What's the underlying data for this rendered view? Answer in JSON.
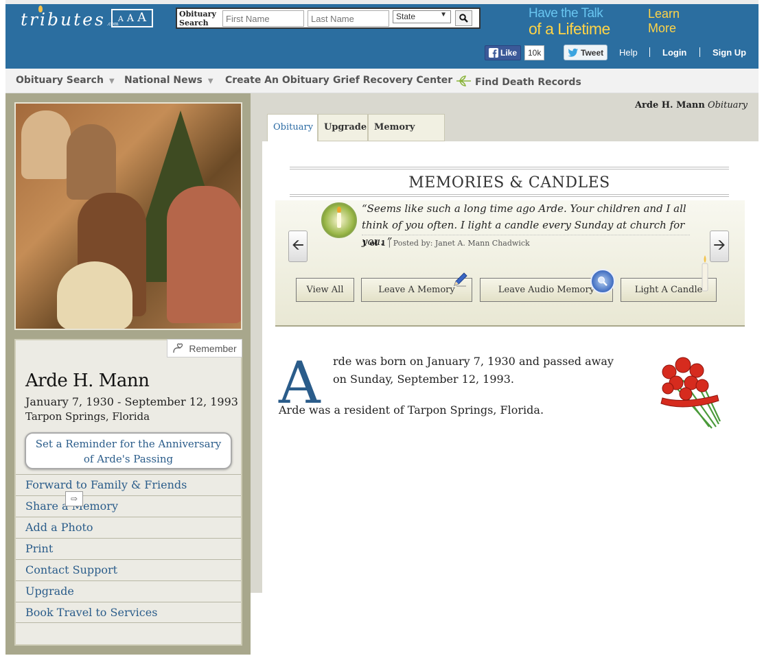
{
  "header": {
    "logo_text": "tributes",
    "logo_dotcom": ".com",
    "font_size_control": [
      "A",
      "A",
      "A"
    ],
    "search": {
      "label_line1": "Obituary",
      "label_line2": "Search",
      "first_name_placeholder": "First Name",
      "last_name_placeholder": "Last Name",
      "state_selected": "State"
    },
    "promo_line1": "Have the Talk",
    "promo_line2": "of a Lifetime",
    "learn_more_line1": "Learn",
    "learn_more_line2": "More",
    "fb_like_label": "Like",
    "fb_like_count": "10k",
    "tweet_label": "Tweet",
    "help_label": "Help",
    "login_label": "Login",
    "signup_label": "Sign Up"
  },
  "nav": {
    "items": [
      {
        "label": "Obituary Search",
        "dropdown": true
      },
      {
        "label": "National News",
        "dropdown": true
      },
      {
        "label": "Create An Obituary",
        "dropdown": false
      },
      {
        "label": "Grief Recovery Center",
        "dropdown": false
      },
      {
        "label": "Find Death Records",
        "dropdown": false
      }
    ]
  },
  "profile": {
    "remember_label": "Remember",
    "name": "Arde H. Mann",
    "dates": "January 7, 1930 - September 12, 1993",
    "location": "Tarpon Springs, Florida",
    "reminder_line1": "Set a Reminder for the Anniversary",
    "reminder_line2": "of Arde's Passing",
    "actions": [
      "Forward to Family & Friends",
      "Share a Memory",
      "Add a Photo",
      "Print",
      "Contact Support",
      "Upgrade",
      "Book Travel to Services"
    ]
  },
  "breadcrumb": {
    "name": "Arde H. Mann",
    "suffix": "Obituary"
  },
  "tabs": [
    {
      "label": "Obituary",
      "active": true
    },
    {
      "label": "Upgrade",
      "active": false
    },
    {
      "label": "Memory Book",
      "active": false
    }
  ],
  "memories": {
    "title": "MEMORIES & CANDLES",
    "quote": "“Seems like such a long time ago Arde. Your children and I all think of you often. I light a candle every Sunday at church for you. ”",
    "counter": "1 of 1",
    "posted_by": "| Posted by: Janet A. Mann Chadwick",
    "buttons": {
      "view_all": "View All",
      "leave_memory": "Leave A Memory",
      "leave_audio": "Leave Audio Memory",
      "light_candle": "Light A Candle"
    }
  },
  "obituary": {
    "drop_cap": "A",
    "paragraph1": "rde was born on January 7, 1930 and passed away on Sunday, September 12, 1993.",
    "paragraph2": "Arde was a resident of Tarpon Springs, Florida."
  },
  "colors": {
    "header_blue": "#2b6ea0",
    "link_blue": "#2a5c8a",
    "promo_yellow": "#ffd447",
    "promo_light_blue": "#69c5f0",
    "sidebar_olive": "#a8a78c"
  }
}
